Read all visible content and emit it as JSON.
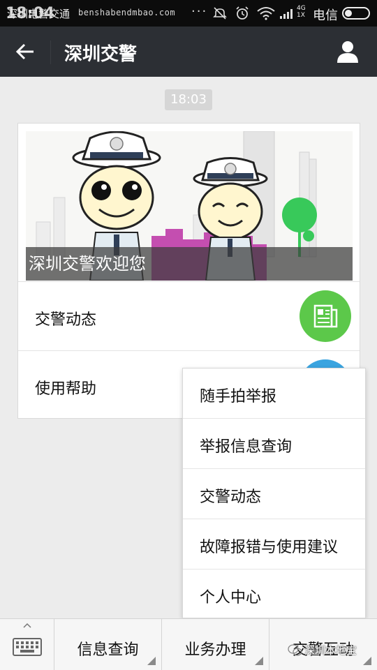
{
  "status_bar": {
    "time": "18:04",
    "overlay_title": "深圳电警交通",
    "overlay_url": "benshabendmbao.com",
    "dots": "···",
    "network": "4G\n1X",
    "carrier": "电信"
  },
  "header": {
    "title": "深圳交警"
  },
  "chat": {
    "timestamp": "18:03",
    "banner_caption": "深圳交警欢迎您",
    "rows": [
      {
        "label": "交警动态",
        "icon_color": "#5cc84a",
        "icon": "newspaper-icon"
      },
      {
        "label": "使用帮助",
        "icon_color": "#3aa4e0",
        "icon": "help-icon"
      }
    ]
  },
  "popup_menu": {
    "items": [
      "随手拍举报",
      "举报信息查询",
      "交警动态",
      "故障报错与使用建议",
      "个人中心"
    ]
  },
  "bottom_bar": {
    "tabs": [
      "信息查询",
      "业务办理",
      "交警互动"
    ],
    "watermark": "深圳本地宝"
  },
  "colors": {
    "header_bg": "#2c2f34",
    "status_bg": "#0c0c0c",
    "accent_green": "#5cc84a",
    "accent_blue": "#3aa4e0"
  }
}
